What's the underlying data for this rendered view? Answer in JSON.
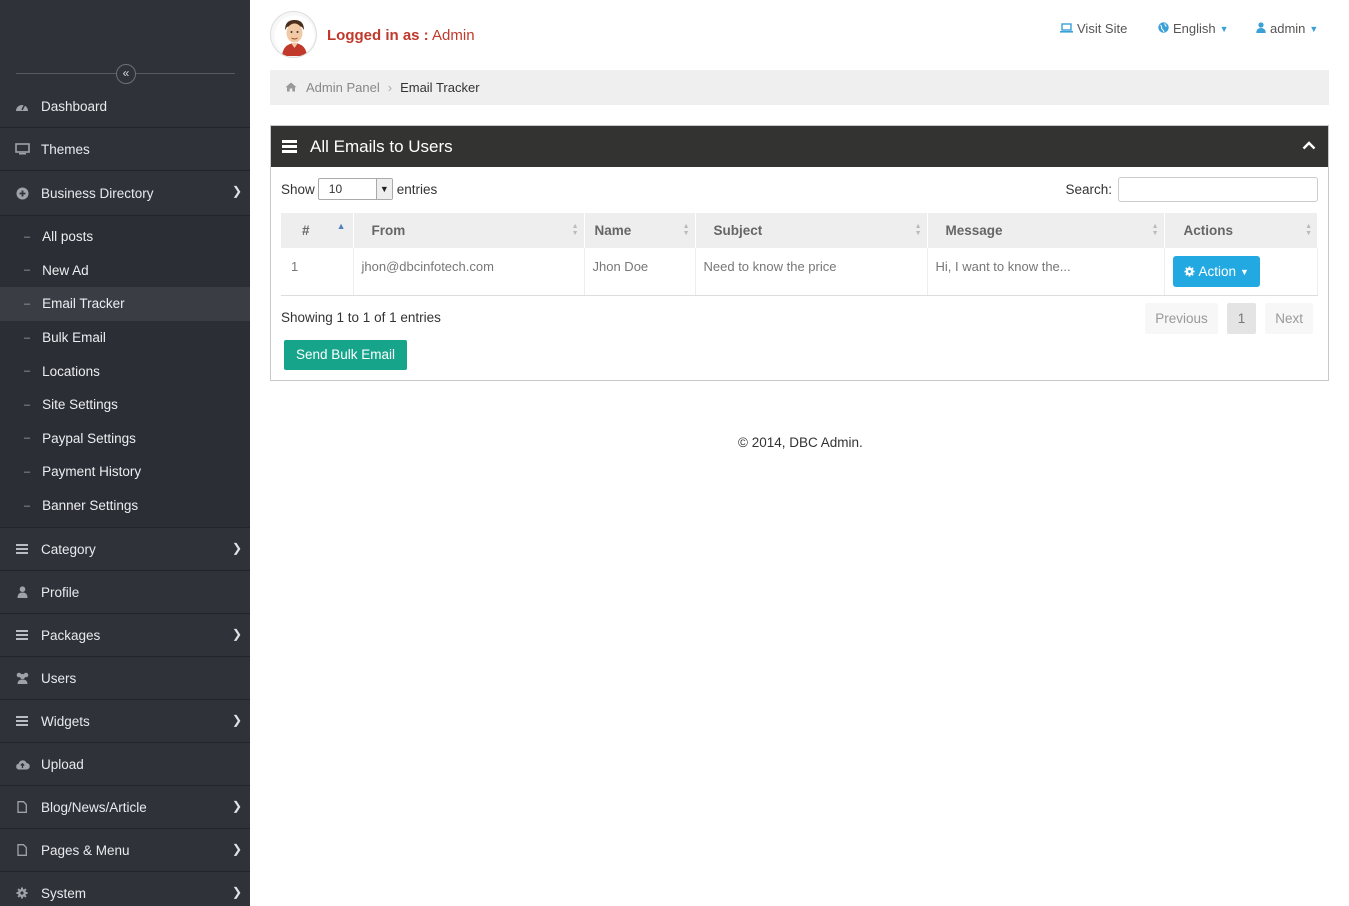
{
  "sidebar": {
    "items_top": [
      {
        "label": "Dashboard",
        "icon": "dashboard-icon"
      },
      {
        "label": "Themes",
        "icon": "monitor-icon"
      },
      {
        "label": "Business Directory",
        "icon": "plus-circle-icon"
      }
    ],
    "sub_items": [
      {
        "label": "All posts"
      },
      {
        "label": "New Ad"
      },
      {
        "label": "Email Tracker"
      },
      {
        "label": "Bulk Email"
      },
      {
        "label": "Locations"
      },
      {
        "label": "Site Settings"
      },
      {
        "label": "Paypal Settings"
      },
      {
        "label": "Payment History"
      },
      {
        "label": "Banner Settings"
      }
    ],
    "items_bottom": [
      {
        "label": "Category",
        "icon": "list-icon"
      },
      {
        "label": "Profile",
        "icon": "user-icon"
      },
      {
        "label": "Packages",
        "icon": "list-icon"
      },
      {
        "label": "Users",
        "icon": "users-icon"
      },
      {
        "label": "Widgets",
        "icon": "list-icon"
      },
      {
        "label": "Upload",
        "icon": "cloud-upload-icon"
      },
      {
        "label": "Blog/News/Article",
        "icon": "file-icon"
      },
      {
        "label": "Pages & Menu",
        "icon": "file-icon"
      },
      {
        "label": "System",
        "icon": "gear-icon"
      }
    ]
  },
  "header": {
    "logged_prefix": "Logged in as :",
    "logged_user": "Admin",
    "visit_site": "Visit Site",
    "language": "English",
    "account": "admin"
  },
  "breadcrumb": {
    "root": "Admin Panel",
    "current": "Email Tracker"
  },
  "panel": {
    "title": "All Emails to Users",
    "show_label": "Show",
    "page_size": "10",
    "entries_label": "entries",
    "search_label": "Search:",
    "columns": [
      "#",
      "From",
      "Name",
      "Subject",
      "Message",
      "Actions"
    ],
    "rows": [
      {
        "num": "1",
        "from": "jhon@dbcinfotech.com",
        "name": "Jhon Doe",
        "subject": "Need to know the price",
        "message": "Hi, I want to know the...",
        "action": "Action"
      }
    ],
    "info": "Showing 1 to 1 of 1 entries",
    "pager": {
      "prev": "Previous",
      "page": "1",
      "next": "Next"
    },
    "bulk_button": "Send Bulk Email"
  },
  "footer": "© 2014, DBC Admin.",
  "colors": {
    "sidebar_bg": "#2f3238",
    "panel_head": "#333332",
    "action_blue": "#23a9e1",
    "bulk_green": "#16a48b",
    "logged_red": "#c0392b"
  }
}
